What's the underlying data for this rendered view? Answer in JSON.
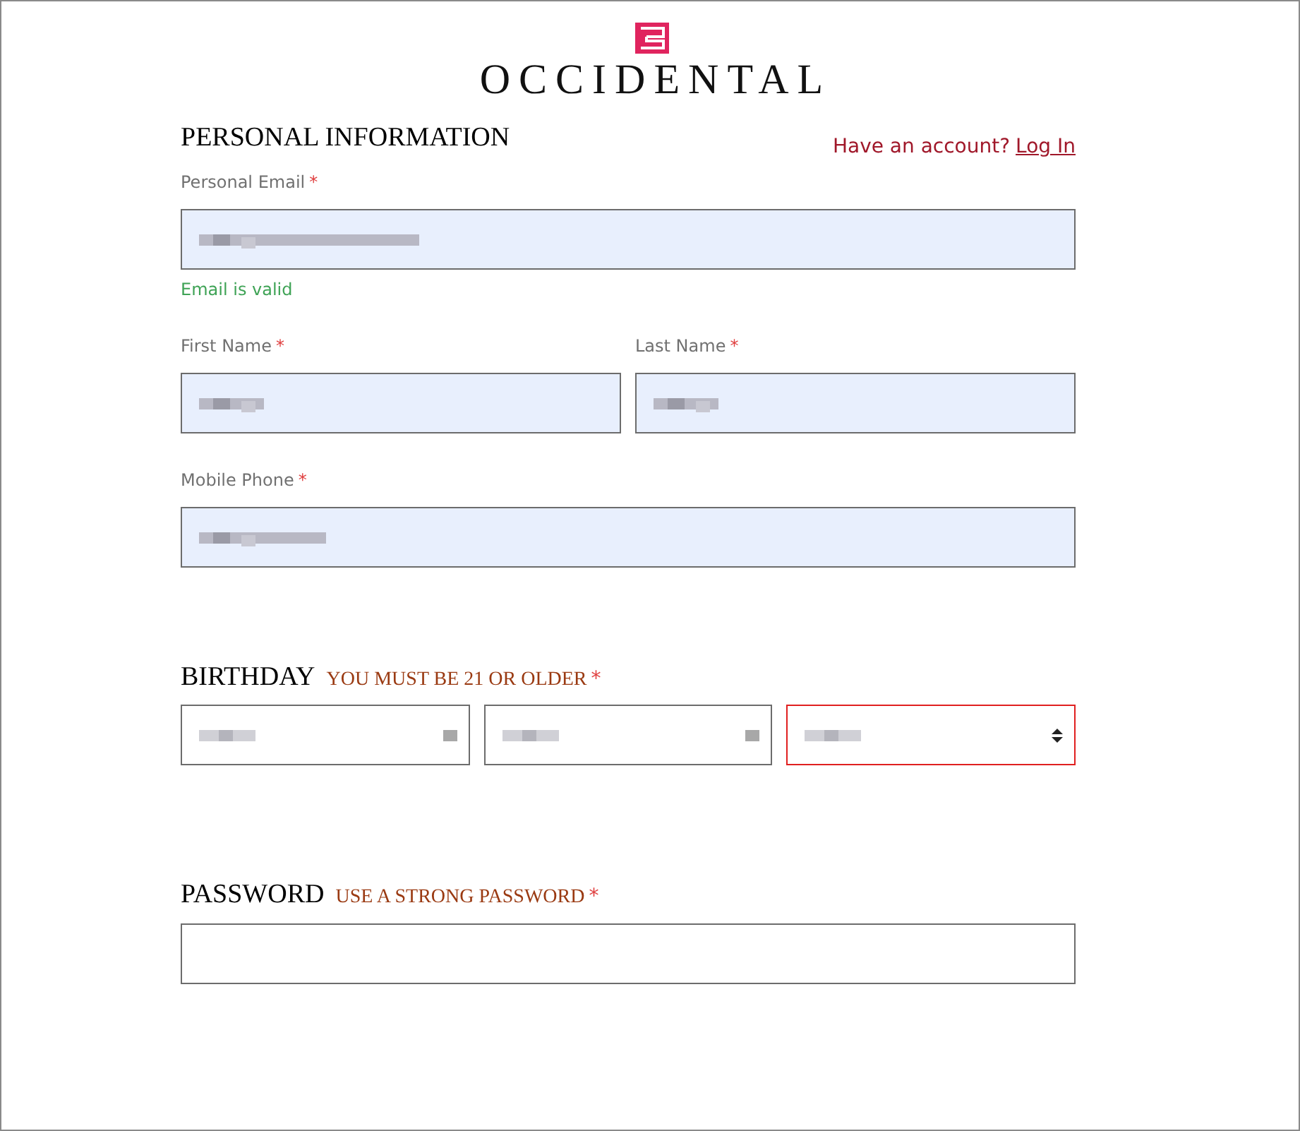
{
  "brand": {
    "name": "OCCIDENTAL"
  },
  "personal": {
    "title": "PERSONAL INFORMATION",
    "account_prompt": "Have an account?",
    "login_link": "Log In",
    "fields": [
      {
        "label": "Personal Email",
        "required_mark": "*",
        "autofilled": true,
        "redacted": true,
        "help": "Email is valid",
        "half": false
      },
      {
        "label": "First Name",
        "required_mark": "*",
        "autofilled": true,
        "redacted": true,
        "half": true
      },
      {
        "label": "Last Name",
        "required_mark": "*",
        "autofilled": true,
        "redacted": true,
        "half": true
      },
      {
        "label": "Mobile Phone",
        "required_mark": "*",
        "autofilled": true,
        "redacted": true,
        "half": false
      }
    ]
  },
  "birthday": {
    "title": "BIRTHDAY",
    "note": "YOU MUST BE 21 OR OLDER",
    "required_mark": "*",
    "selects": [
      {
        "redacted": true,
        "invalid": false,
        "arrows": false
      },
      {
        "redacted": true,
        "invalid": false,
        "arrows": false
      },
      {
        "redacted": true,
        "invalid": true,
        "arrows": true
      }
    ]
  },
  "password": {
    "title": "PASSWORD",
    "note": "USE A STRONG PASSWORD",
    "required_mark": "*"
  }
}
